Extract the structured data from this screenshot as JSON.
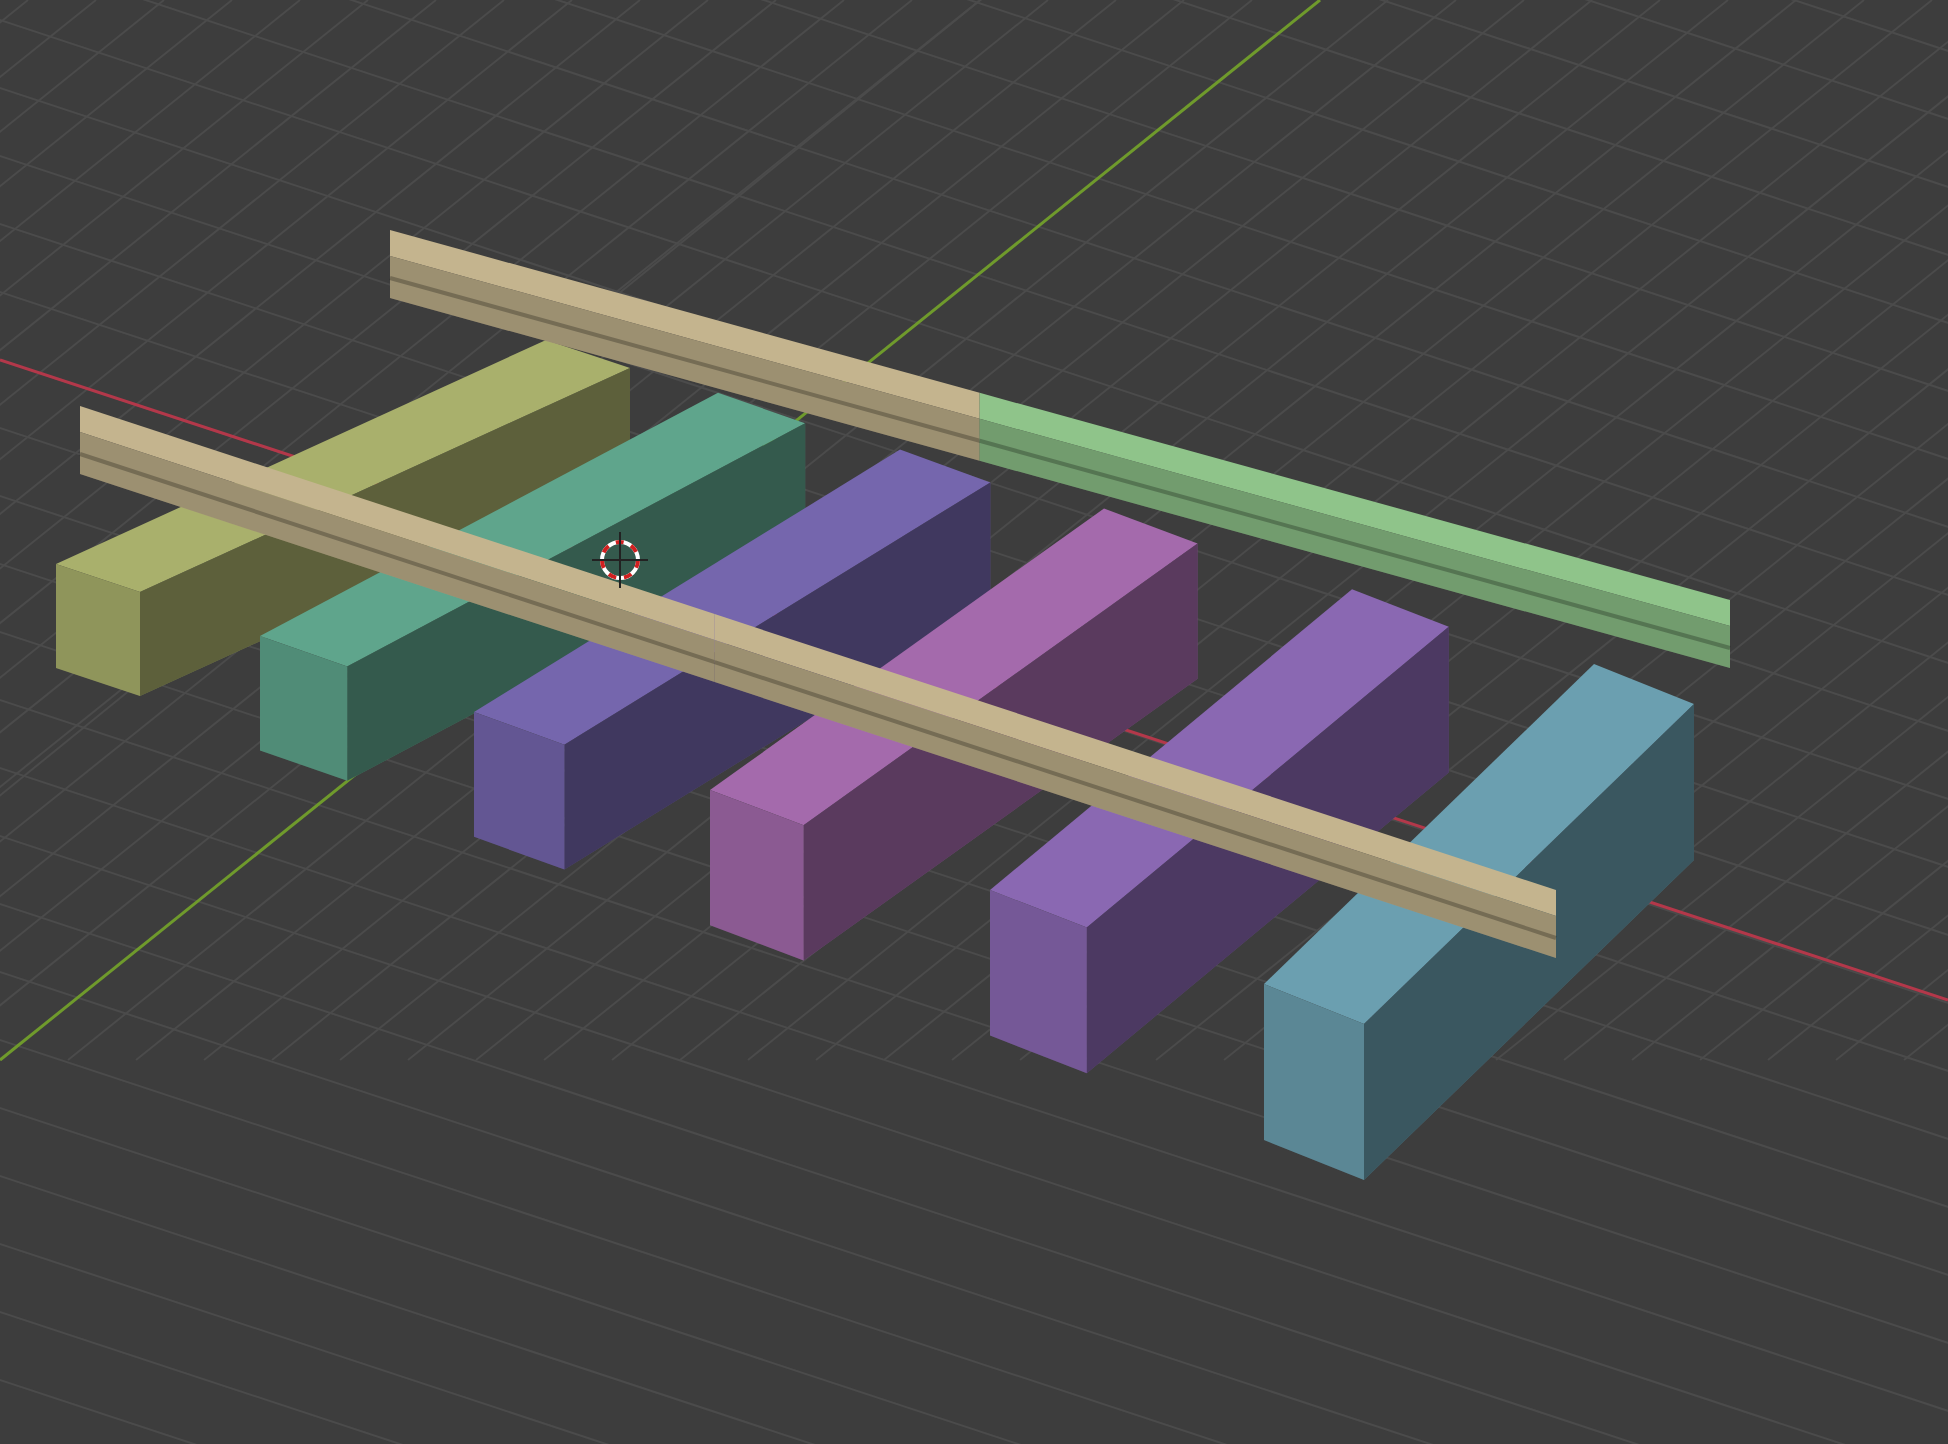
{
  "viewport": {
    "sleepers": [
      {
        "color": "#a9b06c"
      },
      {
        "color": "#5fa58c"
      },
      {
        "color": "#7566ad"
      },
      {
        "color": "#a46aac"
      },
      {
        "color": "#8a68b2"
      },
      {
        "color": "#6b9fb0"
      }
    ],
    "rails": [
      {
        "segments": [
          {
            "color": "#c4b48e"
          },
          {
            "color": "#8fc48a"
          }
        ]
      },
      {
        "segments": [
          {
            "color": "#c4b48e"
          },
          {
            "color": "#c4b48e"
          }
        ]
      }
    ]
  }
}
